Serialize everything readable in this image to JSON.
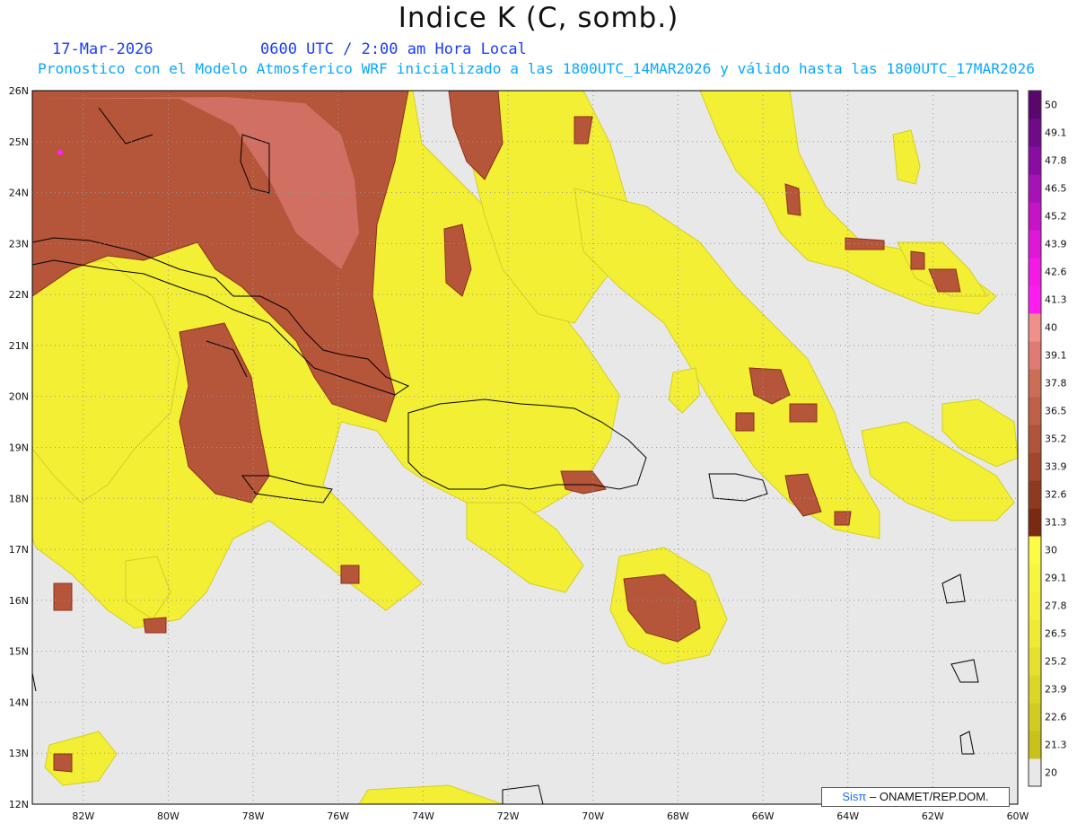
{
  "title": "Indice K (C, somb.)",
  "date": "17-Mar-2026",
  "time_line": "0600 UTC / 2:00 am Hora Local",
  "subtitle": "Pronostico con el Modelo Atmosferico WRF inicializado a las 1800UTC_14MAR2026 y válido hasta las  1800UTC_17MAR2026",
  "credit": {
    "logo": "Sisπ",
    "text": "– ONAMET/REP.DOM."
  },
  "map": {
    "variable": "Indice K",
    "units": "C",
    "lat_labels": [
      "26N",
      "25N",
      "24N",
      "23N",
      "22N",
      "21N",
      "20N",
      "19N",
      "18N",
      "17N",
      "16N",
      "15N",
      "14N",
      "13N",
      "12N"
    ],
    "lon_labels": [
      "82W",
      "80W",
      "78W",
      "76W",
      "74W",
      "72W",
      "70W",
      "68W",
      "66W",
      "64W",
      "62W",
      "60W"
    ],
    "lat_range": [
      12,
      26
    ],
    "lon_range": [
      -83.2,
      -60
    ],
    "grid": "dotted",
    "background_color": "#e8e8e8",
    "coastline_color": "#000000"
  },
  "colorbar": {
    "labels": [
      "20",
      "21.3",
      "22.6",
      "23.9",
      "25.2",
      "26.5",
      "27.8",
      "29.1",
      "30",
      "31.3",
      "32.6",
      "33.9",
      "35.2",
      "36.5",
      "37.8",
      "39.1",
      "40",
      "41.3",
      "42.6",
      "43.9",
      "45.2",
      "46.5",
      "47.8",
      "49.1",
      "50"
    ],
    "colors": [
      "#e8e8e8",
      "#c8c21a",
      "#d2cc22",
      "#dcd62a",
      "#e6e030",
      "#eeea36",
      "#f4f03c",
      "#f8f540",
      "#fdfb44",
      "#7a2a10",
      "#8f3a1e",
      "#a2472b",
      "#b25438",
      "#c06046",
      "#cc6d56",
      "#e07a72",
      "#f0908a",
      "#ff1cf0",
      "#f41ae6",
      "#e016d8",
      "#c612c8",
      "#a810b8",
      "#8a0ca4",
      "#700a88",
      "#5a066e"
    ]
  },
  "highlight_marker": {
    "color": "#ff22ff"
  }
}
